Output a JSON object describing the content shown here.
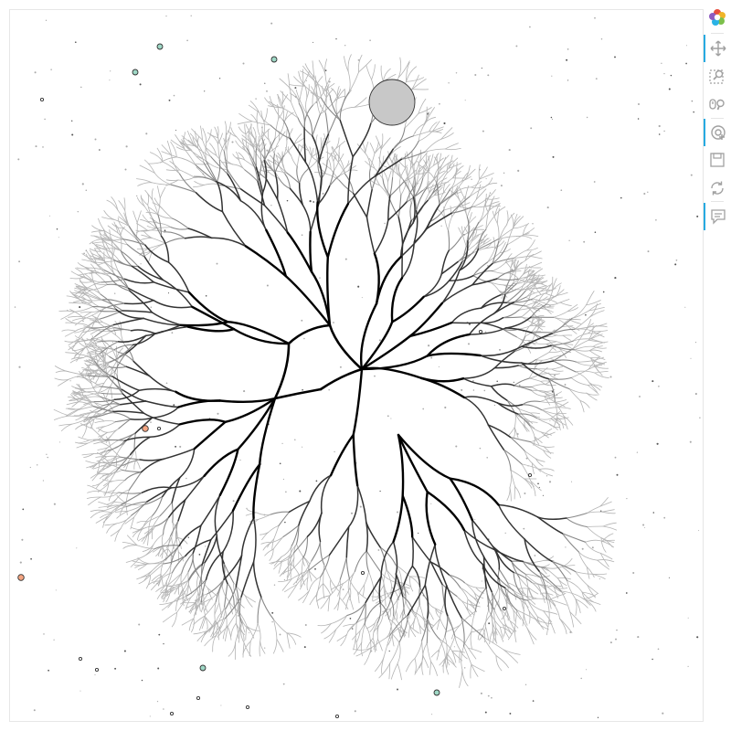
{
  "app": {
    "name": "Bokeh plot"
  },
  "colors": {
    "trunk": "#000000",
    "branch": "#333333",
    "twig": "#888888",
    "fine": "#b4b4b4",
    "big_marker": "#c8c8c8",
    "teal_marker": "#9fd8c6",
    "orange_marker": "#f4a582",
    "accent": "#26aae1",
    "icon": "#a0a0a0"
  },
  "toolbar": {
    "tools": [
      {
        "id": "logo",
        "icon": "bokeh-logo-icon",
        "active": false,
        "interactive": true
      },
      {
        "id": "pan",
        "icon": "pan-icon",
        "active": true,
        "interactive": true
      },
      {
        "id": "box_zoom",
        "icon": "box-zoom-icon",
        "active": false,
        "interactive": true
      },
      {
        "id": "wheel_zoom",
        "icon": "wheel-zoom-icon",
        "active": false,
        "interactive": true
      },
      {
        "id": "tap",
        "icon": "tap-icon",
        "active": true,
        "interactive": true
      },
      {
        "id": "save",
        "icon": "save-icon",
        "active": false,
        "interactive": true
      },
      {
        "id": "reset",
        "icon": "reset-icon",
        "active": false,
        "interactive": true
      },
      {
        "id": "hover",
        "icon": "hover-icon",
        "active": true,
        "interactive": true
      }
    ]
  },
  "plot": {
    "markers": [
      {
        "kind": "large",
        "color": "#c8c8c8"
      },
      {
        "kind": "small",
        "color": "#9fd8c6",
        "count": 7
      },
      {
        "kind": "small",
        "color": "#f4a582",
        "count": 2
      },
      {
        "kind": "tiny",
        "color": "#ffffff",
        "count": 12
      }
    ]
  }
}
